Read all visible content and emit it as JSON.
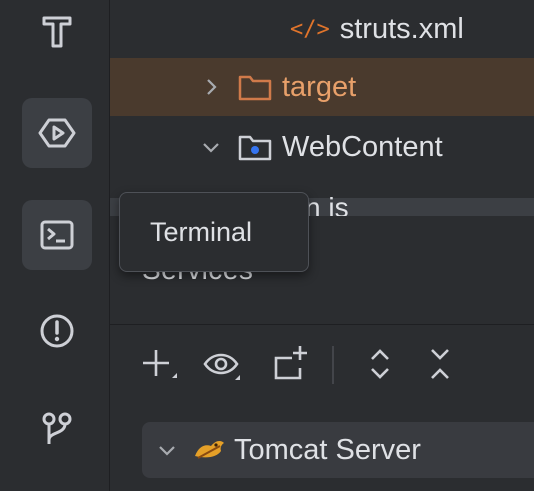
{
  "tree": {
    "items": [
      {
        "label": "struts.xml",
        "icon": "xml-file-icon"
      },
      {
        "label": "target",
        "icon": "folder-icon"
      },
      {
        "label": "WebContent",
        "icon": "web-folder-icon"
      }
    ],
    "partial_text": "n is"
  },
  "tooltip": {
    "text": "Terminal"
  },
  "services": {
    "title": "Services",
    "server": {
      "label": "Tomcat Server"
    }
  },
  "colors": {
    "background": "#2b2d30",
    "highlight_row": "#4a3a2d",
    "folder_orange": "#d07a4a",
    "xml_orange": "#e0742b"
  }
}
